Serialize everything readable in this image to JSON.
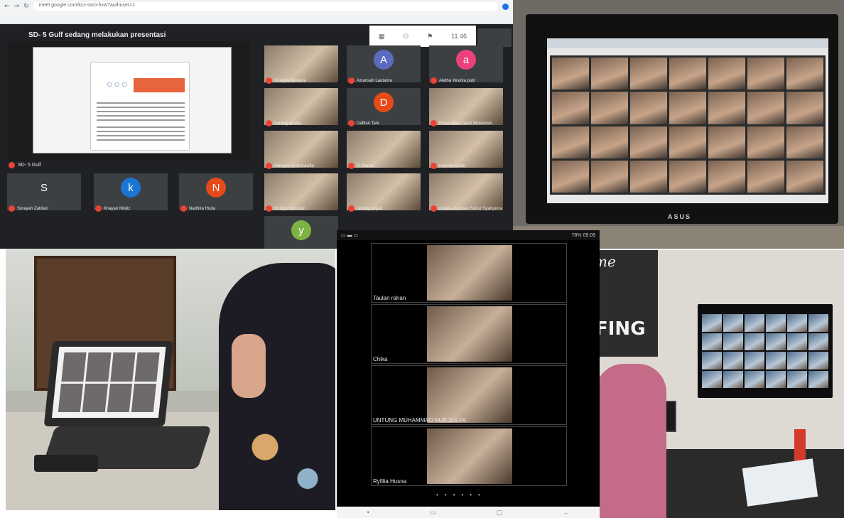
{
  "panel_meet": {
    "browser_url": "meet.google.com/kcs-ssro-hxw?authuser=1",
    "title": "SD- 5 Gulf sedang melakukan presentasi",
    "clock": "11.46",
    "presenter_label": "SD- 5 Gulf",
    "tiles": [
      {
        "name": "Shakyla Miranda",
        "kind": "camera"
      },
      {
        "name": "Aziansah Lautama",
        "kind": "avatar",
        "letter": "A",
        "color": "#5c6bc0"
      },
      {
        "name": "Aletha Yesinta putri",
        "kind": "avatar",
        "letter": "a",
        "color": "#ec407a"
      },
      {
        "name": "farrang amalia",
        "kind": "camera"
      },
      {
        "name": "Daffian Tani",
        "kind": "avatar",
        "letter": "D",
        "color": "#e64a19"
      },
      {
        "name": "Rosa Silvia Tantri Wulandari",
        "kind": "camera"
      },
      {
        "name": "Hilmiyah praharawita",
        "kind": "camera"
      },
      {
        "name": "R Wianto",
        "kind": "camera"
      },
      {
        "name": "Kayvan Adhar",
        "kind": "camera"
      },
      {
        "name": "Sorayah Zaldian",
        "kind": "avatar",
        "letter": "S",
        "color": "#3c4043"
      },
      {
        "name": "Khayan Mistiz",
        "kind": "avatar",
        "letter": "k",
        "color": "#1976d2"
      },
      {
        "name": "Nadhira Huda",
        "kind": "avatar",
        "letter": "N",
        "color": "#e64a19"
      },
      {
        "name": "Nindya Hamidah",
        "kind": "camera"
      },
      {
        "name": "ramzey anjari",
        "kind": "camera"
      },
      {
        "name": "natalia, Keenan Fairuz Syahputra",
        "kind": "camera"
      },
      {
        "name": "",
        "kind": "avatar",
        "letter": "y",
        "color": "#7cb342"
      }
    ]
  },
  "panel_laptop": {
    "brand": "ASUS"
  },
  "panel_phone": {
    "status_right": "78% 09:09",
    "participants": [
      "Taulan rahan",
      "Chika",
      "UNTUNG MUHAMMAD NUR ZULFA",
      "Ryfilia Husna"
    ]
  },
  "panel_tv": {
    "banner_top": "me",
    "banner_text": "FING"
  }
}
